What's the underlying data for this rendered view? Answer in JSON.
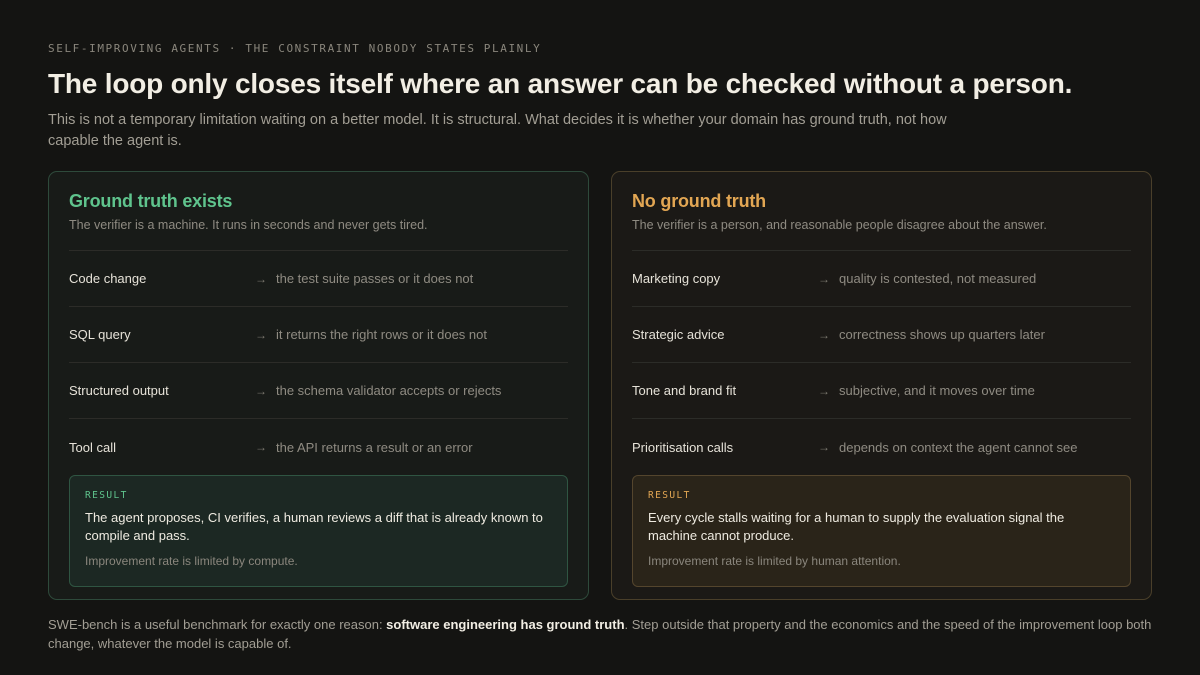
{
  "eyebrow": "SELF-IMPROVING AGENTS · THE CONSTRAINT NOBODY STATES PLAINLY",
  "headline": "The loop only closes itself where an answer can be checked without a person.",
  "subhead": "This is not a temporary limitation waiting on a better model. It is structural. What decides it is whether your domain has ground truth, not how capable the agent is.",
  "colors": {
    "ground_truth_accent": "#5fc48d",
    "no_ground_truth_accent": "#e2a653",
    "background": "#141412"
  },
  "panels": {
    "ground_truth": {
      "title": "Ground truth exists",
      "description": "The verifier is a machine. It runs in seconds and never gets tired.",
      "rows": [
        {
          "label": "Code change",
          "arrow_icon": "→",
          "value": "the test suite passes or it does not"
        },
        {
          "label": "SQL query",
          "arrow_icon": "→",
          "value": "it returns the right rows or it does not"
        },
        {
          "label": "Structured output",
          "arrow_icon": "→",
          "value": "the schema validator accepts or rejects"
        },
        {
          "label": "Tool call",
          "arrow_icon": "→",
          "value": "the API returns a result or an error"
        }
      ],
      "result": {
        "tag": "RESULT",
        "body": "The agent proposes, CI verifies, a human reviews a diff that is already known to compile and pass.",
        "note": "Improvement rate is limited by compute."
      }
    },
    "no_ground_truth": {
      "title": "No ground truth",
      "description": "The verifier is a person, and reasonable people disagree about the answer.",
      "rows": [
        {
          "label": "Marketing copy",
          "arrow_icon": "→",
          "value": "quality is contested, not measured"
        },
        {
          "label": "Strategic advice",
          "arrow_icon": "→",
          "value": "correctness shows up quarters later"
        },
        {
          "label": "Tone and brand fit",
          "arrow_icon": "→",
          "value": "subjective, and it moves over time"
        },
        {
          "label": "Prioritisation calls",
          "arrow_icon": "→",
          "value": "depends on context the agent cannot see"
        }
      ],
      "result": {
        "tag": "RESULT",
        "body": "Every cycle stalls waiting for a human to supply the evaluation signal the machine cannot produce.",
        "note": "Improvement rate is limited by human attention."
      }
    }
  },
  "footer": {
    "before": "SWE-bench is a useful benchmark for exactly one reason: ",
    "emphasis": "software engineering has ground truth",
    "after": ". Step outside that property and the economics and the speed of the improvement loop both change, whatever the model is capable of."
  }
}
